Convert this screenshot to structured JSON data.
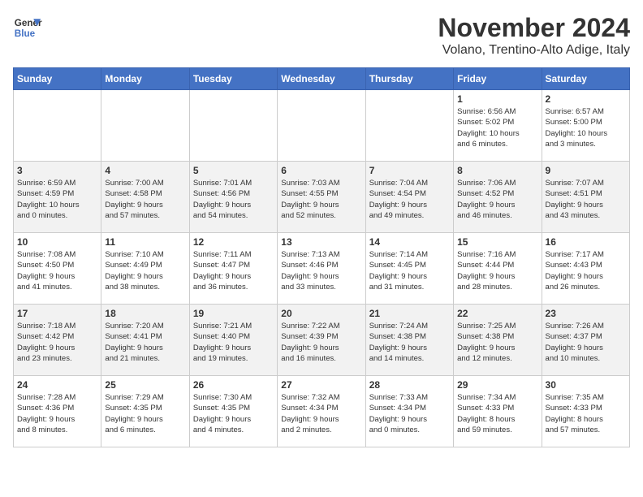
{
  "header": {
    "logo_line1": "General",
    "logo_line2": "Blue",
    "month_title": "November 2024",
    "subtitle": "Volano, Trentino-Alto Adige, Italy"
  },
  "days_of_week": [
    "Sunday",
    "Monday",
    "Tuesday",
    "Wednesday",
    "Thursday",
    "Friday",
    "Saturday"
  ],
  "weeks": [
    [
      {
        "day": "",
        "info": ""
      },
      {
        "day": "",
        "info": ""
      },
      {
        "day": "",
        "info": ""
      },
      {
        "day": "",
        "info": ""
      },
      {
        "day": "",
        "info": ""
      },
      {
        "day": "1",
        "info": "Sunrise: 6:56 AM\nSunset: 5:02 PM\nDaylight: 10 hours\nand 6 minutes."
      },
      {
        "day": "2",
        "info": "Sunrise: 6:57 AM\nSunset: 5:00 PM\nDaylight: 10 hours\nand 3 minutes."
      }
    ],
    [
      {
        "day": "3",
        "info": "Sunrise: 6:59 AM\nSunset: 4:59 PM\nDaylight: 10 hours\nand 0 minutes."
      },
      {
        "day": "4",
        "info": "Sunrise: 7:00 AM\nSunset: 4:58 PM\nDaylight: 9 hours\nand 57 minutes."
      },
      {
        "day": "5",
        "info": "Sunrise: 7:01 AM\nSunset: 4:56 PM\nDaylight: 9 hours\nand 54 minutes."
      },
      {
        "day": "6",
        "info": "Sunrise: 7:03 AM\nSunset: 4:55 PM\nDaylight: 9 hours\nand 52 minutes."
      },
      {
        "day": "7",
        "info": "Sunrise: 7:04 AM\nSunset: 4:54 PM\nDaylight: 9 hours\nand 49 minutes."
      },
      {
        "day": "8",
        "info": "Sunrise: 7:06 AM\nSunset: 4:52 PM\nDaylight: 9 hours\nand 46 minutes."
      },
      {
        "day": "9",
        "info": "Sunrise: 7:07 AM\nSunset: 4:51 PM\nDaylight: 9 hours\nand 43 minutes."
      }
    ],
    [
      {
        "day": "10",
        "info": "Sunrise: 7:08 AM\nSunset: 4:50 PM\nDaylight: 9 hours\nand 41 minutes."
      },
      {
        "day": "11",
        "info": "Sunrise: 7:10 AM\nSunset: 4:49 PM\nDaylight: 9 hours\nand 38 minutes."
      },
      {
        "day": "12",
        "info": "Sunrise: 7:11 AM\nSunset: 4:47 PM\nDaylight: 9 hours\nand 36 minutes."
      },
      {
        "day": "13",
        "info": "Sunrise: 7:13 AM\nSunset: 4:46 PM\nDaylight: 9 hours\nand 33 minutes."
      },
      {
        "day": "14",
        "info": "Sunrise: 7:14 AM\nSunset: 4:45 PM\nDaylight: 9 hours\nand 31 minutes."
      },
      {
        "day": "15",
        "info": "Sunrise: 7:16 AM\nSunset: 4:44 PM\nDaylight: 9 hours\nand 28 minutes."
      },
      {
        "day": "16",
        "info": "Sunrise: 7:17 AM\nSunset: 4:43 PM\nDaylight: 9 hours\nand 26 minutes."
      }
    ],
    [
      {
        "day": "17",
        "info": "Sunrise: 7:18 AM\nSunset: 4:42 PM\nDaylight: 9 hours\nand 23 minutes."
      },
      {
        "day": "18",
        "info": "Sunrise: 7:20 AM\nSunset: 4:41 PM\nDaylight: 9 hours\nand 21 minutes."
      },
      {
        "day": "19",
        "info": "Sunrise: 7:21 AM\nSunset: 4:40 PM\nDaylight: 9 hours\nand 19 minutes."
      },
      {
        "day": "20",
        "info": "Sunrise: 7:22 AM\nSunset: 4:39 PM\nDaylight: 9 hours\nand 16 minutes."
      },
      {
        "day": "21",
        "info": "Sunrise: 7:24 AM\nSunset: 4:38 PM\nDaylight: 9 hours\nand 14 minutes."
      },
      {
        "day": "22",
        "info": "Sunrise: 7:25 AM\nSunset: 4:38 PM\nDaylight: 9 hours\nand 12 minutes."
      },
      {
        "day": "23",
        "info": "Sunrise: 7:26 AM\nSunset: 4:37 PM\nDaylight: 9 hours\nand 10 minutes."
      }
    ],
    [
      {
        "day": "24",
        "info": "Sunrise: 7:28 AM\nSunset: 4:36 PM\nDaylight: 9 hours\nand 8 minutes."
      },
      {
        "day": "25",
        "info": "Sunrise: 7:29 AM\nSunset: 4:35 PM\nDaylight: 9 hours\nand 6 minutes."
      },
      {
        "day": "26",
        "info": "Sunrise: 7:30 AM\nSunset: 4:35 PM\nDaylight: 9 hours\nand 4 minutes."
      },
      {
        "day": "27",
        "info": "Sunrise: 7:32 AM\nSunset: 4:34 PM\nDaylight: 9 hours\nand 2 minutes."
      },
      {
        "day": "28",
        "info": "Sunrise: 7:33 AM\nSunset: 4:34 PM\nDaylight: 9 hours\nand 0 minutes."
      },
      {
        "day": "29",
        "info": "Sunrise: 7:34 AM\nSunset: 4:33 PM\nDaylight: 8 hours\nand 59 minutes."
      },
      {
        "day": "30",
        "info": "Sunrise: 7:35 AM\nSunset: 4:33 PM\nDaylight: 8 hours\nand 57 minutes."
      }
    ]
  ]
}
